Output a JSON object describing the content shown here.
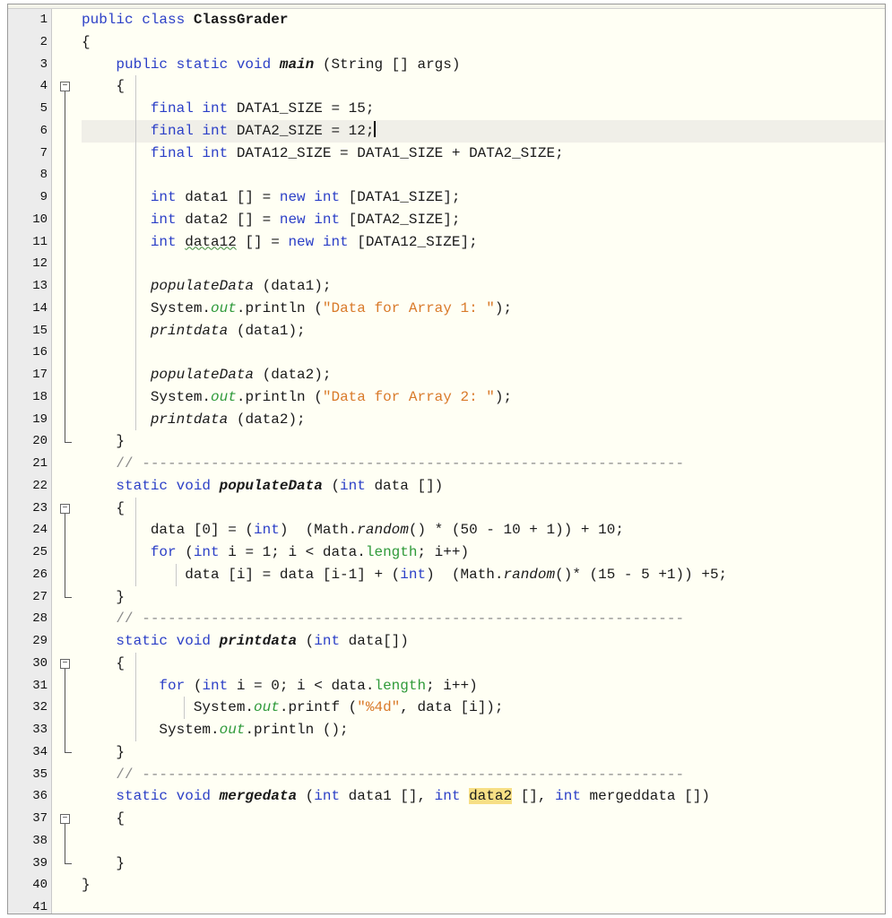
{
  "editor": {
    "current_line": 6,
    "lines": [
      [
        {
          "t": "public class ",
          "c": "kw"
        },
        {
          "t": "ClassGrader",
          "c": "cls"
        }
      ],
      [
        {
          "t": "{",
          "c": ""
        }
      ],
      [
        {
          "t": "    public static void ",
          "c": "kw"
        },
        {
          "t": "main",
          "c": "mb"
        },
        {
          "t": " (String [] args)",
          "c": ""
        }
      ],
      [
        {
          "t": "    {",
          "c": ""
        }
      ],
      [
        {
          "t": "        final int ",
          "c": "kw"
        },
        {
          "t": "DATA1_SIZE = 15;",
          "c": ""
        }
      ],
      [
        {
          "t": "        final int ",
          "c": "kw"
        },
        {
          "t": "DATA2_SIZE = 12;",
          "c": ""
        },
        {
          "t": "",
          "c": "caret"
        }
      ],
      [
        {
          "t": "        final int ",
          "c": "kw"
        },
        {
          "t": "DATA12_SIZE = DATA1_SIZE + DATA2_SIZE;",
          "c": ""
        }
      ],
      [],
      [
        {
          "t": "        int ",
          "c": "kw"
        },
        {
          "t": "data1 [] = ",
          "c": ""
        },
        {
          "t": "new int ",
          "c": "kw"
        },
        {
          "t": "[DATA1_SIZE];",
          "c": ""
        }
      ],
      [
        {
          "t": "        int ",
          "c": "kw"
        },
        {
          "t": "data2 [] = ",
          "c": ""
        },
        {
          "t": "new int ",
          "c": "kw"
        },
        {
          "t": "[DATA2_SIZE];",
          "c": ""
        }
      ],
      [
        {
          "t": "        int ",
          "c": "kw"
        },
        {
          "t": "data12",
          "c": "squig"
        },
        {
          "t": " [] = ",
          "c": ""
        },
        {
          "t": "new int ",
          "c": "kw"
        },
        {
          "t": "[DATA12_SIZE];",
          "c": ""
        }
      ],
      [],
      [
        {
          "t": "        ",
          "c": ""
        },
        {
          "t": "populateData",
          "c": "mi"
        },
        {
          "t": " (data1);",
          "c": ""
        }
      ],
      [
        {
          "t": "        System.",
          "c": ""
        },
        {
          "t": "out",
          "c": "sf"
        },
        {
          "t": ".println (",
          "c": ""
        },
        {
          "t": "\"Data for Array 1: \"",
          "c": "str"
        },
        {
          "t": ");",
          "c": ""
        }
      ],
      [
        {
          "t": "        ",
          "c": ""
        },
        {
          "t": "printdata",
          "c": "mi"
        },
        {
          "t": " (data1);",
          "c": ""
        }
      ],
      [],
      [
        {
          "t": "        ",
          "c": ""
        },
        {
          "t": "populateData",
          "c": "mi"
        },
        {
          "t": " (data2);",
          "c": ""
        }
      ],
      [
        {
          "t": "        System.",
          "c": ""
        },
        {
          "t": "out",
          "c": "sf"
        },
        {
          "t": ".println (",
          "c": ""
        },
        {
          "t": "\"Data for Array 2: \"",
          "c": "str"
        },
        {
          "t": ");",
          "c": ""
        }
      ],
      [
        {
          "t": "        ",
          "c": ""
        },
        {
          "t": "printdata",
          "c": "mi"
        },
        {
          "t": " (data2);",
          "c": ""
        }
      ],
      [
        {
          "t": "    }",
          "c": ""
        }
      ],
      [
        {
          "t": "    // ---------------------------------------------------------------",
          "c": "cmt"
        }
      ],
      [
        {
          "t": "    static void ",
          "c": "kw"
        },
        {
          "t": "populateData",
          "c": "mb"
        },
        {
          "t": " (",
          "c": ""
        },
        {
          "t": "int ",
          "c": "kw"
        },
        {
          "t": "data [])",
          "c": ""
        }
      ],
      [
        {
          "t": "    {",
          "c": ""
        }
      ],
      [
        {
          "t": "        data [0] = (",
          "c": ""
        },
        {
          "t": "int",
          "c": "kw"
        },
        {
          "t": ")  (Math.",
          "c": ""
        },
        {
          "t": "random",
          "c": "mi"
        },
        {
          "t": "() * (50 - 10 + 1)) + 10;",
          "c": ""
        }
      ],
      [
        {
          "t": "        for ",
          "c": "kw"
        },
        {
          "t": "(",
          "c": ""
        },
        {
          "t": "int ",
          "c": "kw"
        },
        {
          "t": "i = 1; i < data.",
          "c": ""
        },
        {
          "t": "length",
          "c": "fld"
        },
        {
          "t": "; i++)",
          "c": ""
        }
      ],
      [
        {
          "t": "            data [i] = data [i-1] + (",
          "c": ""
        },
        {
          "t": "int",
          "c": "kw"
        },
        {
          "t": ")  (Math.",
          "c": ""
        },
        {
          "t": "random",
          "c": "mi"
        },
        {
          "t": "()* (15 - 5 +1)) +5;",
          "c": ""
        }
      ],
      [
        {
          "t": "    }",
          "c": ""
        }
      ],
      [
        {
          "t": "    // ---------------------------------------------------------------",
          "c": "cmt"
        }
      ],
      [
        {
          "t": "    static void ",
          "c": "kw"
        },
        {
          "t": "printdata",
          "c": "mb"
        },
        {
          "t": " (",
          "c": ""
        },
        {
          "t": "int ",
          "c": "kw"
        },
        {
          "t": "data[])",
          "c": ""
        }
      ],
      [
        {
          "t": "    {",
          "c": ""
        }
      ],
      [
        {
          "t": "         for ",
          "c": "kw"
        },
        {
          "t": "(",
          "c": ""
        },
        {
          "t": "int ",
          "c": "kw"
        },
        {
          "t": "i = 0; i < data.",
          "c": ""
        },
        {
          "t": "length",
          "c": "fld"
        },
        {
          "t": "; i++)",
          "c": ""
        }
      ],
      [
        {
          "t": "             System.",
          "c": ""
        },
        {
          "t": "out",
          "c": "sf"
        },
        {
          "t": ".printf (",
          "c": ""
        },
        {
          "t": "\"%4d\"",
          "c": "str"
        },
        {
          "t": ", data [i]);",
          "c": ""
        }
      ],
      [
        {
          "t": "         System.",
          "c": ""
        },
        {
          "t": "out",
          "c": "sf"
        },
        {
          "t": ".println ();",
          "c": ""
        }
      ],
      [
        {
          "t": "    }",
          "c": ""
        }
      ],
      [
        {
          "t": "    // ---------------------------------------------------------------",
          "c": "cmt"
        }
      ],
      [
        {
          "t": "    static void ",
          "c": "kw"
        },
        {
          "t": "mergedata",
          "c": "mb"
        },
        {
          "t": " (",
          "c": ""
        },
        {
          "t": "int ",
          "c": "kw"
        },
        {
          "t": "data1 [], ",
          "c": ""
        },
        {
          "t": "int ",
          "c": "kw"
        },
        {
          "t": "data2",
          "c": "hl"
        },
        {
          "t": " [], ",
          "c": ""
        },
        {
          "t": "int ",
          "c": "kw"
        },
        {
          "t": "mergeddata [])",
          "c": ""
        }
      ],
      [
        {
          "t": "    {",
          "c": ""
        }
      ],
      [],
      [
        {
          "t": "    }",
          "c": ""
        }
      ],
      [
        {
          "t": "}",
          "c": ""
        }
      ],
      []
    ],
    "line_numbers": [
      "1",
      "2",
      "3",
      "4",
      "5",
      "6",
      "7",
      "8",
      "9",
      "10",
      "11",
      "12",
      "13",
      "14",
      "15",
      "16",
      "17",
      "18",
      "19",
      "20",
      "21",
      "22",
      "23",
      "24",
      "25",
      "26",
      "27",
      "28",
      "29",
      "30",
      "31",
      "32",
      "33",
      "34",
      "35",
      "36",
      "37",
      "38",
      "39",
      "40",
      "41"
    ],
    "fold_marker_glyph": "−",
    "folds": [
      {
        "start": 4,
        "end": 20
      },
      {
        "start": 23,
        "end": 27
      },
      {
        "start": 30,
        "end": 34
      },
      {
        "start": 37,
        "end": 39
      }
    ]
  }
}
